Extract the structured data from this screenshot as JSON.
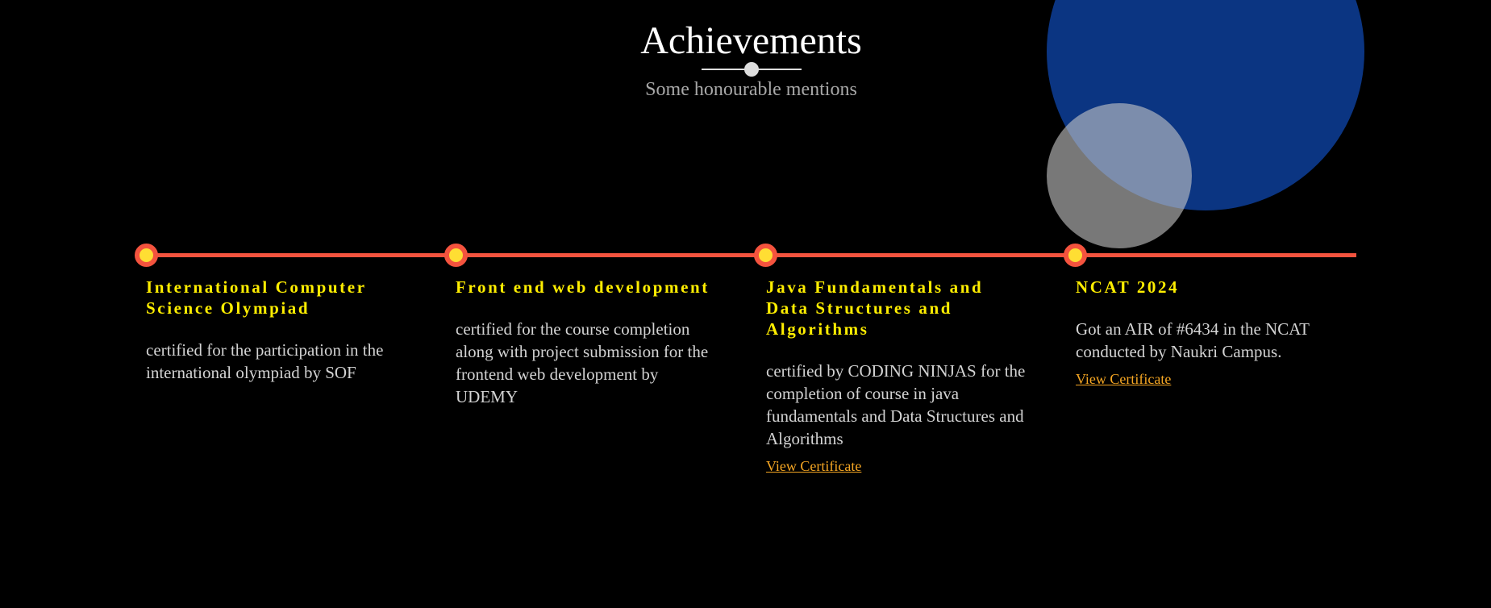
{
  "header": {
    "title": "Achievements",
    "subtitle": "Some honourable mentions"
  },
  "colors": {
    "background": "#000000",
    "timeline": "#f4533e",
    "marker_fill": "#ffde33",
    "item_title": "#ffee00",
    "link": "#f5a623",
    "circle_blue": "#0b3582",
    "circle_grey": "#c8c8c8"
  },
  "achievements": [
    {
      "title": "International Computer Science Olympiad",
      "description": "certified for the participation in the international olympiad by SOF",
      "link": ""
    },
    {
      "title": "Front end web development",
      "description": "certified for the course completion along with project submission for the frontend web development by UDEMY",
      "link": ""
    },
    {
      "title": "Java Fundamentals and Data Structures and Algorithms",
      "description": "certified by CODING NINJAS for the completion of course in java fundamentals and Data Structures and Algorithms",
      "link": "View Certificate"
    },
    {
      "title": "NCAT 2024",
      "description": "Got an AIR of #6434 in the NCAT conducted by Naukri Campus.",
      "link": "View Certificate"
    }
  ]
}
